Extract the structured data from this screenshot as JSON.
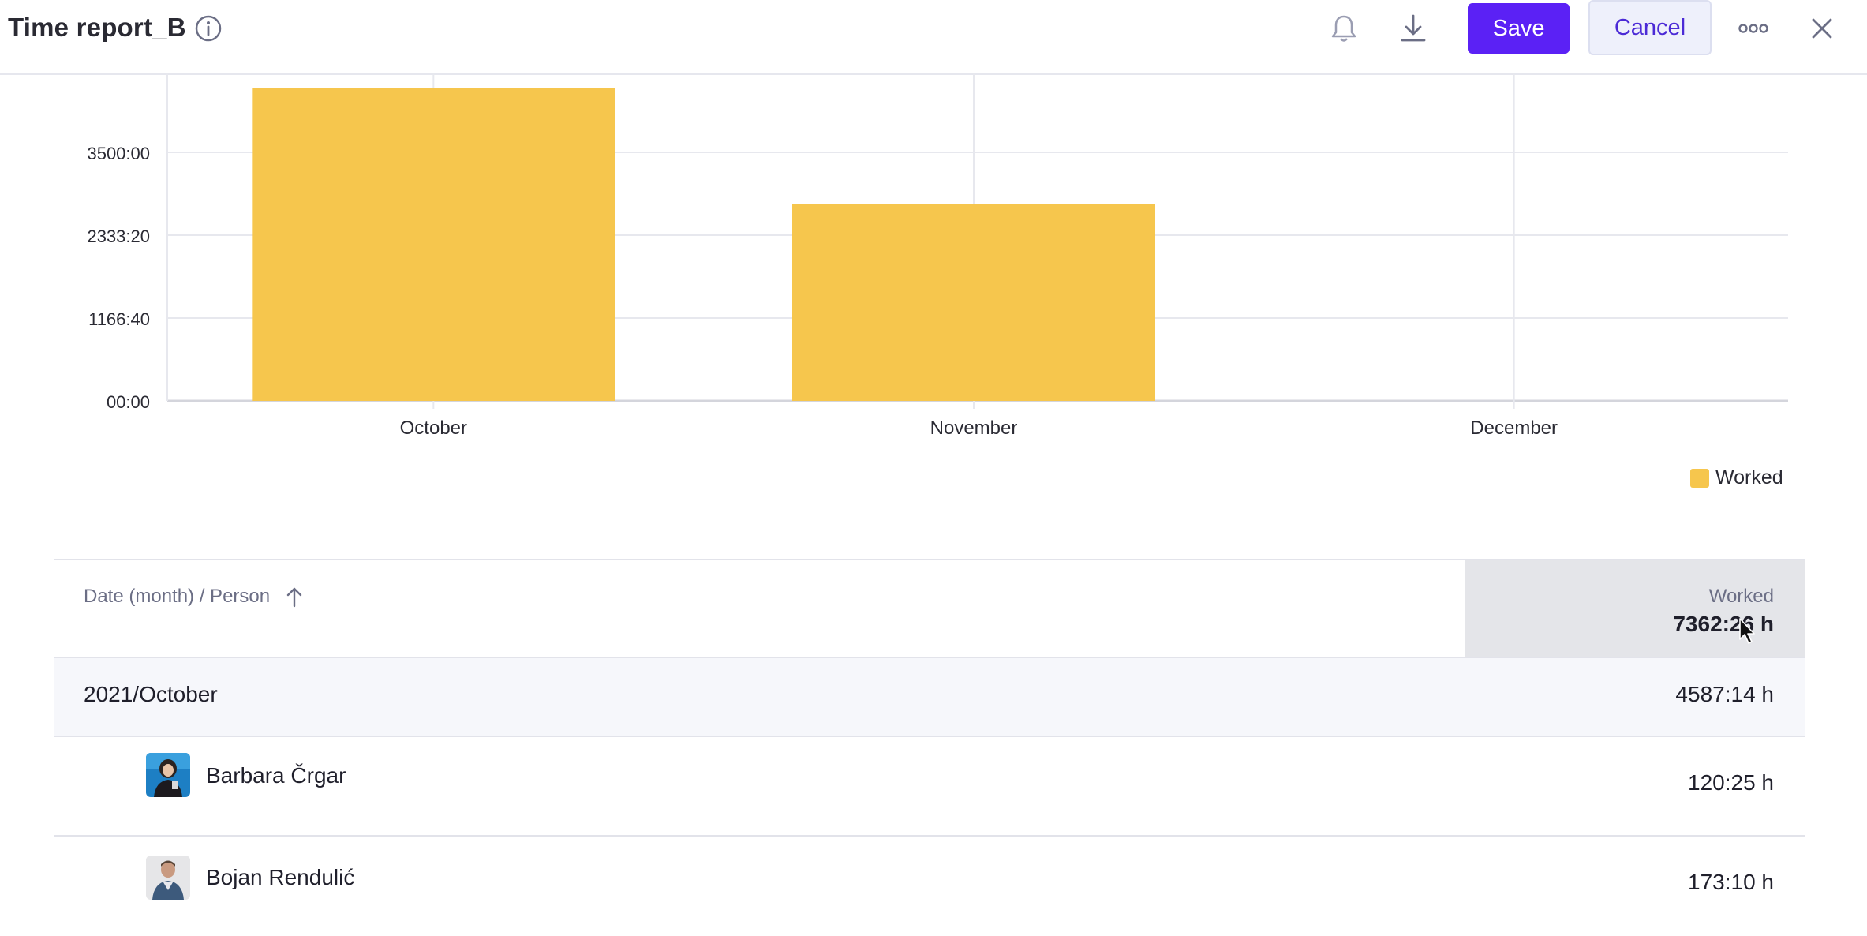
{
  "header": {
    "title": "Time report_B",
    "save_label": "Save",
    "cancel_label": "Cancel",
    "icons": [
      "info-icon",
      "bell-icon",
      "download-icon",
      "more-icon",
      "close-icon"
    ]
  },
  "chart_data": {
    "type": "bar",
    "categories": [
      "October",
      "November",
      "December"
    ],
    "series": [
      {
        "name": "Worked",
        "values": [
          4587.23,
          2775.2,
          0
        ],
        "color": "#f6c64d"
      }
    ],
    "yticks": [
      {
        "value": 0,
        "label": "00:00"
      },
      {
        "value": 1166.67,
        "label": "1166:40"
      },
      {
        "value": 2333.33,
        "label": "2333:20"
      },
      {
        "value": 3500,
        "label": "3500:00"
      }
    ],
    "ylim": [
      0,
      4400
    ],
    "grid": true,
    "legend": "bottom-right"
  },
  "table": {
    "col_label": "Date (month) / Person",
    "worked_label": "Worked",
    "total": "7362:26 h",
    "groups": [
      {
        "label": "2021/October",
        "value": "4587:14 h",
        "people": [
          {
            "name": "Barbara Črgar",
            "value": "120:25 h"
          },
          {
            "name": "Bojan Rendulić",
            "value": "173:10 h"
          }
        ]
      }
    ]
  }
}
